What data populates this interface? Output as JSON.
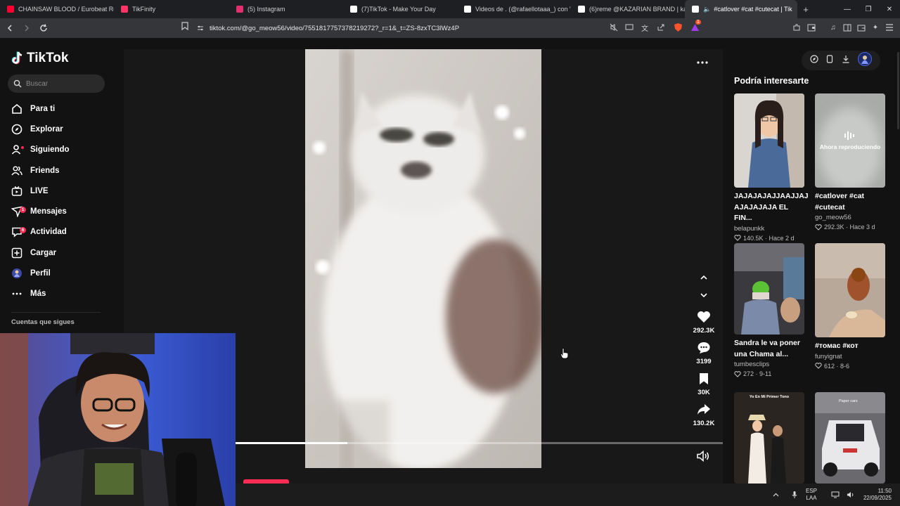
{
  "browser": {
    "tabs": [
      {
        "label": "CHAINSAW BLOOD / Eurobeat Remi",
        "color": "#ff0033"
      },
      {
        "label": "TikFinity",
        "color": "#ff3366"
      },
      {
        "label": "(5) Instagram",
        "color": "#e1306c"
      },
      {
        "label": "(7)TikTok - Make Your Day",
        "color": "#ffffff"
      },
      {
        "label": "Videos de . (@rafaellotaaa_) con \"so",
        "color": "#ffffff"
      },
      {
        "label": "(6)reme @KAZARIAN BRAND | kaza",
        "color": "#ffffff"
      },
      {
        "label": "#catlover #cat #cutecat | Tik",
        "color": "#ffffff"
      }
    ],
    "url": "tiktok.com/@go_meow56/video/7551817757378219272?_r=1&_t=ZS-8zxTC3lWz4P",
    "extension_badge": "1"
  },
  "sidebar": {
    "logo": "TikTok",
    "search_placeholder": "Buscar",
    "items": [
      {
        "label": "Para ti",
        "icon": "home-icon"
      },
      {
        "label": "Explorar",
        "icon": "compass-icon"
      },
      {
        "label": "Siguiendo",
        "icon": "following-icon"
      },
      {
        "label": "Friends",
        "icon": "friends-icon"
      },
      {
        "label": "LIVE",
        "icon": "live-icon"
      },
      {
        "label": "Mensajes",
        "icon": "messages-icon",
        "badge": "1"
      },
      {
        "label": "Actividad",
        "icon": "activity-icon",
        "badge": "6"
      },
      {
        "label": "Cargar",
        "icon": "upload-icon"
      },
      {
        "label": "Perfil",
        "icon": "avatar-icon"
      },
      {
        "label": "Más",
        "icon": "more-icon"
      }
    ],
    "following_accounts_label": "Cuentas que sigues"
  },
  "video": {
    "likes": "292.3K",
    "comments": "3199",
    "saves": "30K",
    "shares": "130.2K",
    "progress": 0.23
  },
  "recommendations": {
    "title": "Podría interesarte",
    "now_playing": "Ahora reproduciendo",
    "cards": [
      {
        "title": "JAJAJAJAJJAAJJAJ AJAJAJAJA EL FIN...",
        "author": "belapunkk",
        "likes": "140.5K",
        "date": "Hace 2 d"
      },
      {
        "title": "#catlover #cat #cutecat",
        "author": "go_meow56",
        "likes": "292.3K",
        "date": "Hace 3 d"
      },
      {
        "title": "Sandra le va poner una Chama al...",
        "author": "tumbesclips",
        "likes": "272",
        "date": "9-11"
      },
      {
        "title": "#томас #кот",
        "author": "funyignat",
        "likes": "612",
        "date": "8-6"
      },
      {
        "caption": "Yo En Mi Primer Tono"
      },
      {
        "caption": "Paper cars"
      }
    ]
  },
  "taskbar": {
    "lang_top": "ESP",
    "lang_bottom": "LAA",
    "time": "11:50",
    "date": "22/09/2025"
  }
}
